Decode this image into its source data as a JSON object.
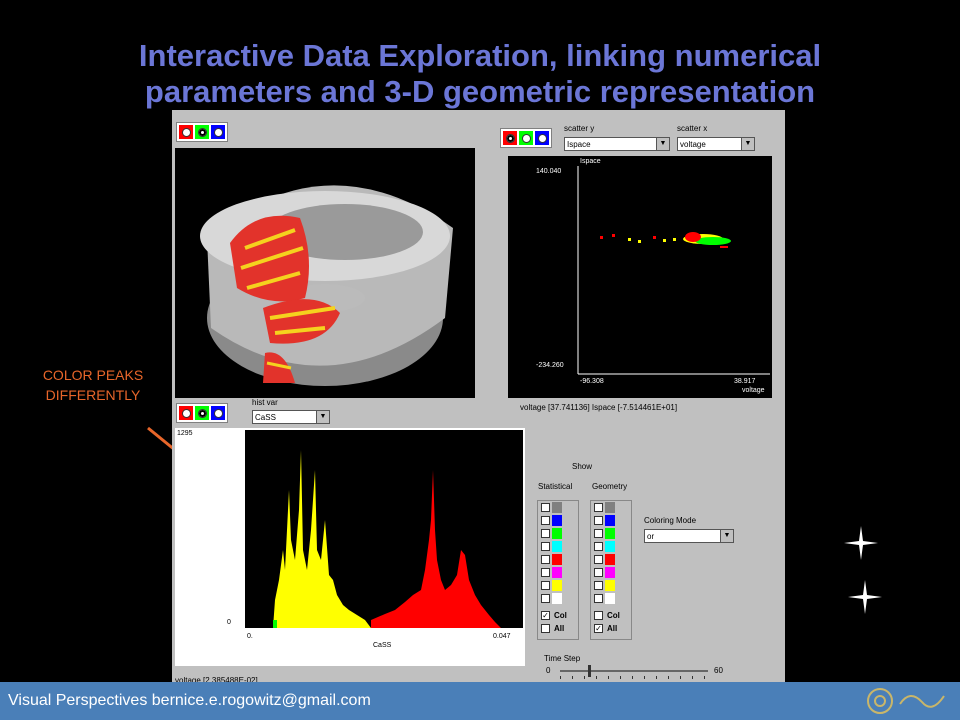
{
  "slide_title_line1": "Interactive Data Exploration, linking numerical",
  "slide_title_line2": "parameters and 3-D geometric representation",
  "annotation_line1": "COLOR PEAKS",
  "annotation_line2": "DIFFERENTLY",
  "footer_text": "Visual Perspectives bernice.e.rogowitz@gmail.com",
  "scatter": {
    "y_label": "scatter y",
    "x_label": "scatter x",
    "y_value": "Ispace",
    "x_value": "voltage",
    "plot_y_title": "Ispace",
    "y_max": "140.040",
    "y_min": "-234.260",
    "x_min": "-96.308",
    "x_max": "38.917",
    "x_axis_name": "voltage",
    "readout": "voltage [37.741136] Ispace [-7.514461E+01]"
  },
  "hist": {
    "var_label": "hist var",
    "var_value": "CaSS",
    "y_max": "1295",
    "y_min": "0",
    "x_min": "0.",
    "x_max": "0.047",
    "x_axis_name": "CaSS",
    "readout": "voltage [2.385488E-02]"
  },
  "show": {
    "title": "Show",
    "statistical": "Statistical",
    "geometry": "Geometry",
    "col": "Col",
    "all": "All",
    "swatch_colors": [
      "#808080",
      "#0000ff",
      "#00ff00",
      "#00ffff",
      "#ff0000",
      "#ff00ff",
      "#ffff00",
      "#ffffff"
    ]
  },
  "coloring": {
    "label": "Coloring Mode",
    "value": "or"
  },
  "time_step": {
    "label": "Time Step",
    "min": "0",
    "max": "60"
  }
}
